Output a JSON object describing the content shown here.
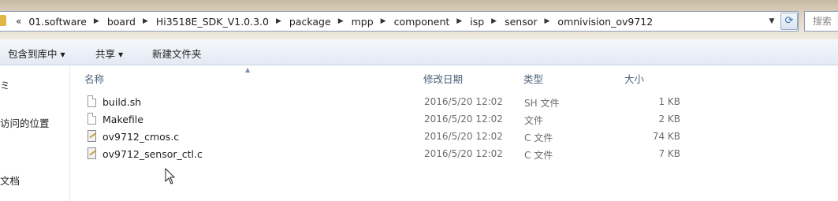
{
  "address_bar": {
    "overflow_label": "«",
    "crumbs": [
      "01.software",
      "board",
      "Hi3518E_SDK_V1.0.3.0",
      "package",
      "mpp",
      "component",
      "isp",
      "sensor",
      "omnivision_ov9712"
    ],
    "search_placeholder": "搜索"
  },
  "toolbar": {
    "include_library": "包含到库中",
    "share": "共享",
    "new_folder": "新建文件夹"
  },
  "nav": {
    "items": [
      "ミ",
      "访问的位置",
      "文档"
    ]
  },
  "columns": {
    "name": "名称",
    "modified": "修改日期",
    "type": "类型",
    "size": "大小"
  },
  "files": [
    {
      "name": "build.sh",
      "modified": "2016/5/20 12:02",
      "type": "SH 文件",
      "size": "1 KB",
      "icon": "blank-document-icon"
    },
    {
      "name": "Makefile",
      "modified": "2016/5/20 12:02",
      "type": "文件",
      "size": "2 KB",
      "icon": "blank-document-icon"
    },
    {
      "name": "ov9712_cmos.c",
      "modified": "2016/5/20 12:02",
      "type": "C 文件",
      "size": "74 KB",
      "icon": "c-source-file-icon"
    },
    {
      "name": "ov9712_sensor_ctl.c",
      "modified": "2016/5/20 12:02",
      "type": "C 文件",
      "size": "7 KB",
      "icon": "c-source-file-icon"
    }
  ],
  "colors": {
    "address_border": "#8c9db4",
    "header_text": "#4c607a",
    "folder": "#e2b645"
  }
}
